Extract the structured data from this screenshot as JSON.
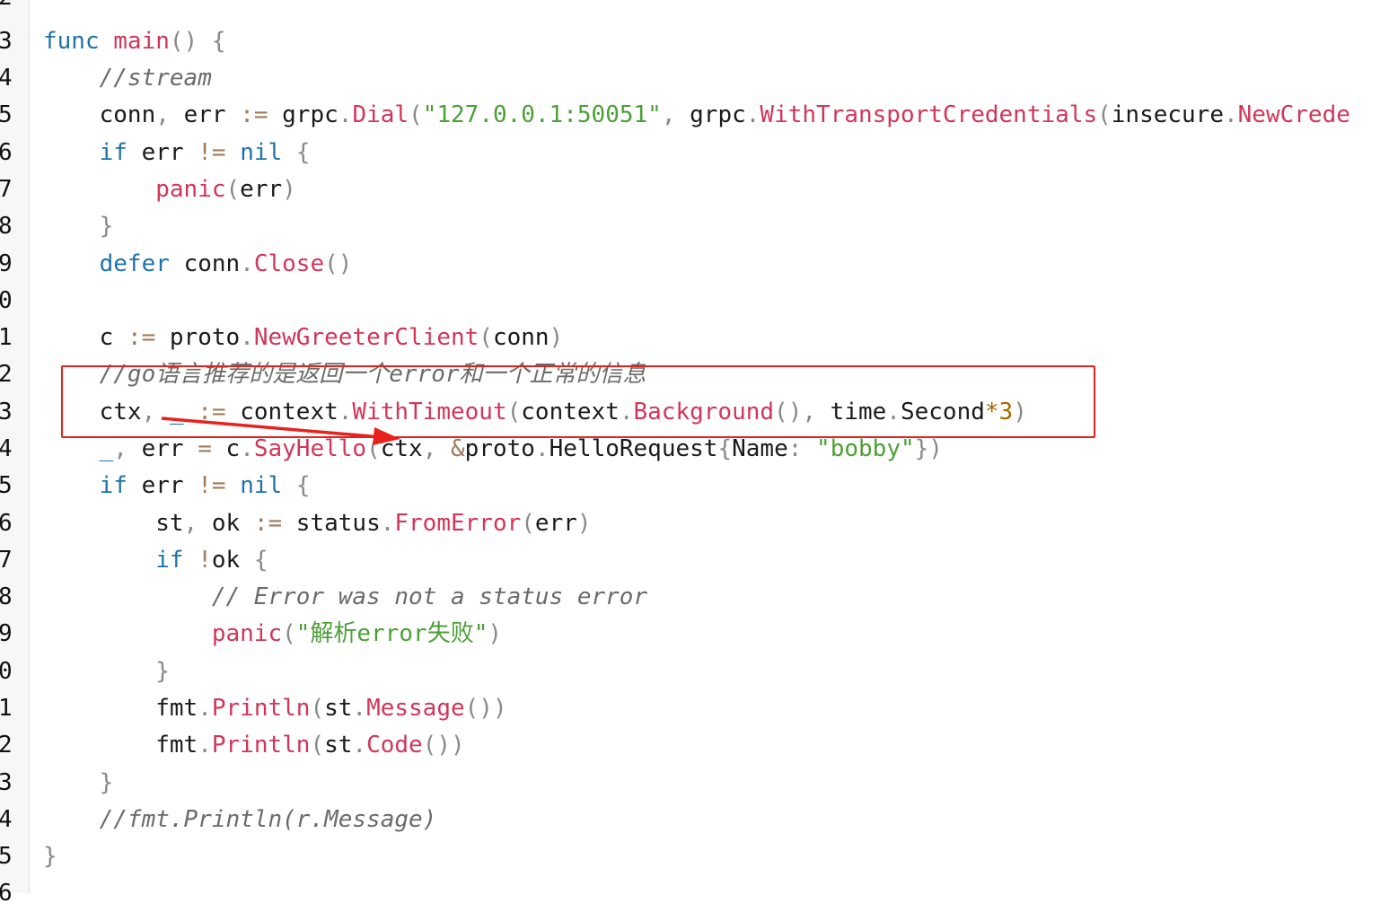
{
  "line_numbers": [
    "2",
    "3",
    "4",
    "5",
    "6",
    "7",
    "8",
    "9",
    "0",
    "1",
    "2",
    "3",
    "4",
    "5",
    "6",
    "7",
    "8",
    "9",
    "0",
    "1",
    "2",
    "3",
    "4",
    "5",
    "6"
  ],
  "code": {
    "l03": {
      "t1": "func",
      "t2": "main",
      "t3": "()",
      "t4": "{"
    },
    "l04": {
      "c1": "//stream"
    },
    "l05": {
      "t1": "conn",
      "t2": ",",
      "t3": "err",
      "t4": ":=",
      "t5": "grpc",
      "t6": ".",
      "t7": "Dial",
      "t8": "(",
      "t9": "\"127.0.0.1:50051\"",
      "t10": ",",
      "t11": "grpc",
      "t12": ".",
      "t13": "WithTransportCredentials",
      "t14": "(",
      "t15": "insecure",
      "t16": ".",
      "t17": "NewCrede"
    },
    "l06": {
      "t1": "if",
      "t2": "err",
      "t3": "!=",
      "t4": "nil",
      "t5": "{"
    },
    "l07": {
      "t1": "panic",
      "t2": "(",
      "t3": "err",
      "t4": ")"
    },
    "l08": {
      "t1": "}"
    },
    "l09": {
      "t1": "defer",
      "t2": "conn",
      "t3": ".",
      "t4": "Close",
      "t5": "()"
    },
    "l11": {
      "t1": "c",
      "t2": ":=",
      "t3": "proto",
      "t4": ".",
      "t5": "NewGreeterClient",
      "t6": "(",
      "t7": "conn",
      "t8": ")"
    },
    "l12": {
      "c1": "//go语言推荐的是返回一个error和一个正常的信息"
    },
    "l13": {
      "t1": "ctx",
      "t2": ",",
      "t3": "_",
      "t4": ":=",
      "t5": "context",
      "t6": ".",
      "t7": "WithTimeout",
      "t8": "(",
      "t9": "context",
      "t10": ".",
      "t11": "Background",
      "t12": "(),",
      "t13": "time",
      "t14": ".",
      "t15": "Second",
      "t16": "*",
      "t17": "3",
      "t18": ")"
    },
    "l14": {
      "t1": "_",
      "t2": ",",
      "t3": "err",
      "t4": "=",
      "t5": "c",
      "t6": ".",
      "t7": "SayHello",
      "t8": "(",
      "t9": "ctx",
      "t10": ",",
      "t11": "&",
      "t12": "proto",
      "t13": ".",
      "t14": "HelloRequest",
      "t15": "{",
      "t16": "Name",
      "t17": ":",
      "t18": "\"bobby\"",
      "t19": "})"
    },
    "l15": {
      "t1": "if",
      "t2": "err",
      "t3": "!=",
      "t4": "nil",
      "t5": "{"
    },
    "l16": {
      "t1": "st",
      "t2": ",",
      "t3": "ok",
      "t4": ":=",
      "t5": "status",
      "t6": ".",
      "t7": "FromError",
      "t8": "(",
      "t9": "err",
      "t10": ")"
    },
    "l17": {
      "t1": "if",
      "t2": "!",
      "t3": "ok",
      "t4": "{"
    },
    "l18": {
      "c1": "// Error was not a status error"
    },
    "l19": {
      "t1": "panic",
      "t2": "(",
      "t3": "\"解析error失败\"",
      "t4": ")"
    },
    "l20": {
      "t1": "}"
    },
    "l21": {
      "t1": "fmt",
      "t2": ".",
      "t3": "Println",
      "t4": "(",
      "t5": "st",
      "t6": ".",
      "t7": "Message",
      "t8": "())"
    },
    "l22": {
      "t1": "fmt",
      "t2": ".",
      "t3": "Println",
      "t4": "(",
      "t5": "st",
      "t6": ".",
      "t7": "Code",
      "t8": "())"
    },
    "l23": {
      "t1": "}"
    },
    "l24": {
      "c1": "//fmt.Println(r.Message)"
    },
    "l25": {
      "t1": "}"
    }
  },
  "colors": {
    "keyword": "#1d73a8",
    "function": "#d1365a",
    "string": "#4d9f38",
    "number": "#a36a00",
    "comment": "#6b6b6b",
    "annotation": "#e8211c"
  }
}
